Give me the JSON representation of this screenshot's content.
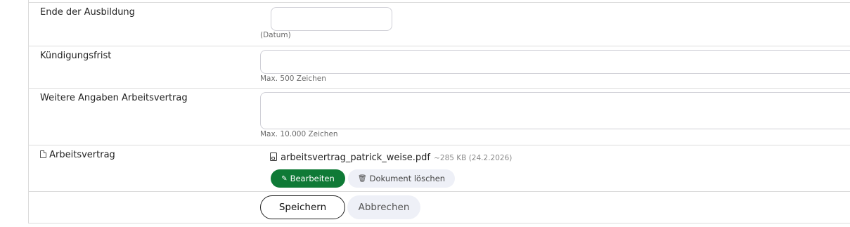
{
  "fields": {
    "end_training": {
      "label": "Ende der Ausbildung",
      "value": "",
      "hint": "(Datum)"
    },
    "notice_period": {
      "label": "Kündigungsfrist",
      "value": "",
      "hint": "Max. 500 Zeichen"
    },
    "contract_details": {
      "label": "Weitere Angaben Arbeitsvertrag",
      "value": "",
      "hint": "Max. 10.000 Zeichen"
    }
  },
  "attachment": {
    "label": "Arbeitsvertrag",
    "label_icon": "file-icon",
    "file_icon": "pdf-icon",
    "file_name": "arbeitsvertrag_patrick_weise.pdf",
    "file_meta": "~285 KB (24.2.2026)",
    "edit_icon": "pencil-icon",
    "edit_label": "Bearbeiten",
    "delete_icon": "trash-icon",
    "delete_label": "Dokument löschen"
  },
  "actions": {
    "save_label": "Speichern",
    "cancel_label": "Abbrechen"
  },
  "colors": {
    "primary_green": "#0f7a36",
    "secondary_bg": "#eef0f7",
    "border": "#dcdcdc"
  }
}
